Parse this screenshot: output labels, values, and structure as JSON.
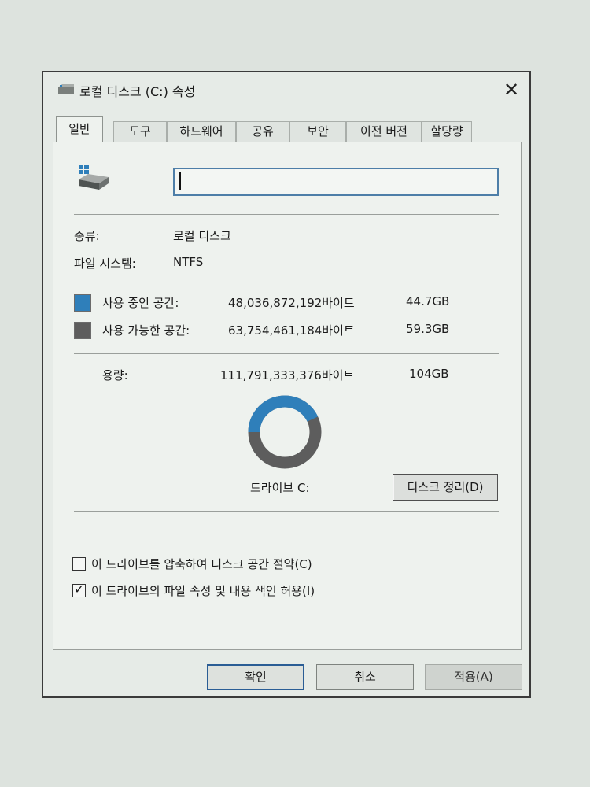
{
  "window": {
    "title": "로컬 디스크 (C:) 속성",
    "close_symbol": "✕",
    "title_icon": "drive-icon"
  },
  "tabs": [
    {
      "label": "일반",
      "active": true
    },
    {
      "label": "도구"
    },
    {
      "label": "하드웨어"
    },
    {
      "label": "공유"
    },
    {
      "label": "보안"
    },
    {
      "label": "이전 버전"
    },
    {
      "label": "할당량"
    }
  ],
  "general": {
    "drive_name_value": "",
    "type_label": "종류:",
    "type_value": "로컬 디스크",
    "fs_label": "파일 시스템:",
    "fs_value": "NTFS",
    "used_label": "사용 중인 공간:",
    "used_bytes": "48,036,872,192바이트",
    "used_size": "44.7GB",
    "free_label": "사용 가능한 공간:",
    "free_bytes": "63,754,461,184바이트",
    "free_size": "59.3GB",
    "capacity_label": "용량:",
    "capacity_bytes": "111,791,333,376바이트",
    "capacity_size": "104GB",
    "drive_label": "드라이브 C:",
    "cleanup_button": "디스크 정리(D)",
    "used_fraction": 0.4297,
    "used_color": "#2f7fba",
    "free_color": "#5d5d5d",
    "compress_label": "이 드라이브를 압축하여 디스크 공간 절약(C)",
    "compress_checked": false,
    "index_label": "이 드라이브의 파일 속성 및 내용 색인 허용(I)",
    "index_checked": true
  },
  "buttons": {
    "ok": "확인",
    "cancel": "취소",
    "apply": "적용(A)"
  }
}
